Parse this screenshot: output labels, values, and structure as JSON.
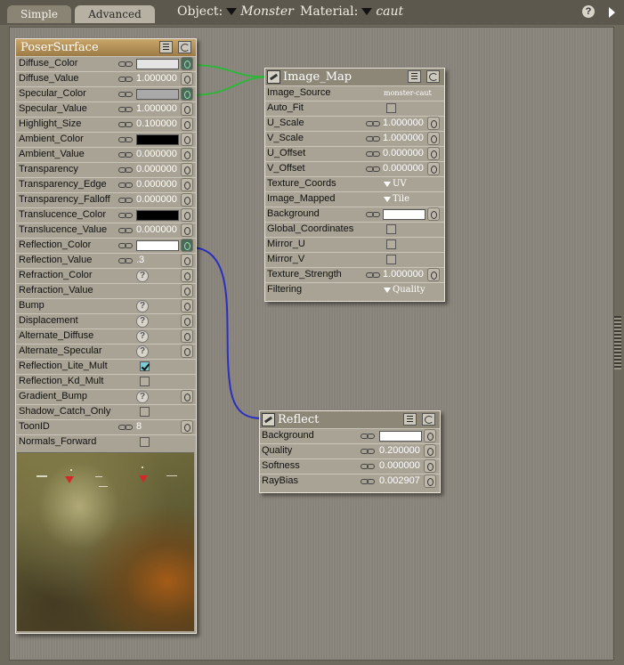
{
  "tabs": [
    {
      "label": "Simple",
      "active": false
    },
    {
      "label": "Advanced",
      "active": true
    }
  ],
  "object_selector": {
    "label": "Object:",
    "value": "Monster"
  },
  "material_selector": {
    "label": "Material:",
    "value": "caut"
  },
  "toolbar_icons": [
    "help-icon",
    "menu-arrow-icon"
  ],
  "colors": {
    "background": "#6f6a5e",
    "canvas": "#88837a",
    "node_body": "#a8a394",
    "poser_header": "#c9a56a",
    "wire_green": "#2fb53a",
    "wire_blue": "#2a2fc0"
  },
  "poser_surface": {
    "title": "PoserSurface",
    "rows": [
      {
        "label": "Diffuse_Color",
        "link": true,
        "swatch": "#e4e4e4",
        "plug": "connected"
      },
      {
        "label": "Diffuse_Value",
        "link": true,
        "value": "1.000000",
        "plug": "normal"
      },
      {
        "label": "Specular_Color",
        "link": true,
        "swatch": "#a9a9a9",
        "plug": "connected"
      },
      {
        "label": "Specular_Value",
        "link": true,
        "value": "1.000000",
        "plug": "normal"
      },
      {
        "label": "Highlight_Size",
        "link": true,
        "value": "0.100000",
        "plug": "normal"
      },
      {
        "label": "Ambient_Color",
        "link": true,
        "swatch": "#000000",
        "plug": "normal"
      },
      {
        "label": "Ambient_Value",
        "link": true,
        "value": "0.000000",
        "plug": "normal"
      },
      {
        "label": "Transparency",
        "link": true,
        "value": "0.000000",
        "plug": "normal"
      },
      {
        "label": "Transparency_Edge",
        "link": true,
        "value": "0.000000",
        "plug": "normal"
      },
      {
        "label": "Transparency_Falloff",
        "link": true,
        "value": "0.000000",
        "plug": "normal"
      },
      {
        "label": "Translucence_Color",
        "link": true,
        "swatch": "#000000",
        "plug": "normal"
      },
      {
        "label": "Translucence_Value",
        "link": true,
        "value": "0.000000",
        "plug": "normal"
      },
      {
        "label": "Reflection_Color",
        "link": true,
        "swatch": "#ffffff",
        "plug": "connected"
      },
      {
        "label": "Reflection_Value",
        "link": true,
        "value": ".3",
        "plug": "normal"
      },
      {
        "label": "Refraction_Color",
        "help": true,
        "plug": "normal"
      },
      {
        "label": "Refraction_Value",
        "plug": "normal"
      },
      {
        "label": "Bump",
        "help": true,
        "plug": "normal"
      },
      {
        "label": "Displacement",
        "help": true,
        "plug": "normal"
      },
      {
        "label": "Alternate_Diffuse",
        "help": true,
        "plug": "normal"
      },
      {
        "label": "Alternate_Specular",
        "help": true,
        "plug": "normal"
      },
      {
        "label": "Reflection_Lite_Mult",
        "checkbox": true
      },
      {
        "label": "Reflection_Kd_Mult",
        "checkbox": false
      },
      {
        "label": "Gradient_Bump",
        "help": true,
        "plug": "normal"
      },
      {
        "label": "Shadow_Catch_Only",
        "checkbox": false
      },
      {
        "label": "ToonID",
        "link": true,
        "value": "8",
        "plug": "normal"
      },
      {
        "label": "Normals_Forward",
        "checkbox": false
      }
    ]
  },
  "image_map": {
    "title": "Image_Map",
    "rows": [
      {
        "label": "Image_Source",
        "file": "monster-caut"
      },
      {
        "label": "Auto_Fit",
        "checkbox": false
      },
      {
        "label": "U_Scale",
        "link": true,
        "value": "1.000000",
        "plug": "normal"
      },
      {
        "label": "V_Scale",
        "link": true,
        "value": "1.000000",
        "plug": "normal"
      },
      {
        "label": "U_Offset",
        "link": true,
        "value": "0.000000",
        "plug": "normal"
      },
      {
        "label": "V_Offset",
        "link": true,
        "value": "0.000000",
        "plug": "normal"
      },
      {
        "label": "Texture_Coords",
        "dropdown": "UV"
      },
      {
        "label": "Image_Mapped",
        "dropdown": "Tile"
      },
      {
        "label": "Background",
        "link": true,
        "swatch": "#ffffff",
        "plug": "normal"
      },
      {
        "label": "Global_Coordinates",
        "checkbox": false
      },
      {
        "label": "Mirror_U",
        "checkbox": false
      },
      {
        "label": "Mirror_V",
        "checkbox": false
      },
      {
        "label": "Texture_Strength",
        "link": true,
        "value": "1.000000",
        "plug": "normal"
      },
      {
        "label": "Filtering",
        "dropdown": "Quality"
      }
    ]
  },
  "reflect": {
    "title": "Reflect",
    "rows": [
      {
        "label": "Background",
        "link": true,
        "swatch": "#ffffff",
        "plug": "normal"
      },
      {
        "label": "Quality",
        "link": true,
        "value": "0.200000",
        "plug": "normal"
      },
      {
        "label": "Softness",
        "link": true,
        "value": "0.000000",
        "plug": "normal"
      },
      {
        "label": "RayBias",
        "link": true,
        "value": "0.002907",
        "plug": "normal"
      }
    ]
  },
  "connections": [
    {
      "from": "image_map.output",
      "to": "poser_surface.Diffuse_Color",
      "color": "#2fb53a"
    },
    {
      "from": "image_map.output",
      "to": "poser_surface.Specular_Color",
      "color": "#2fb53a"
    },
    {
      "from": "reflect.output",
      "to": "poser_surface.Reflection_Color",
      "color": "#2a2fc0"
    }
  ]
}
